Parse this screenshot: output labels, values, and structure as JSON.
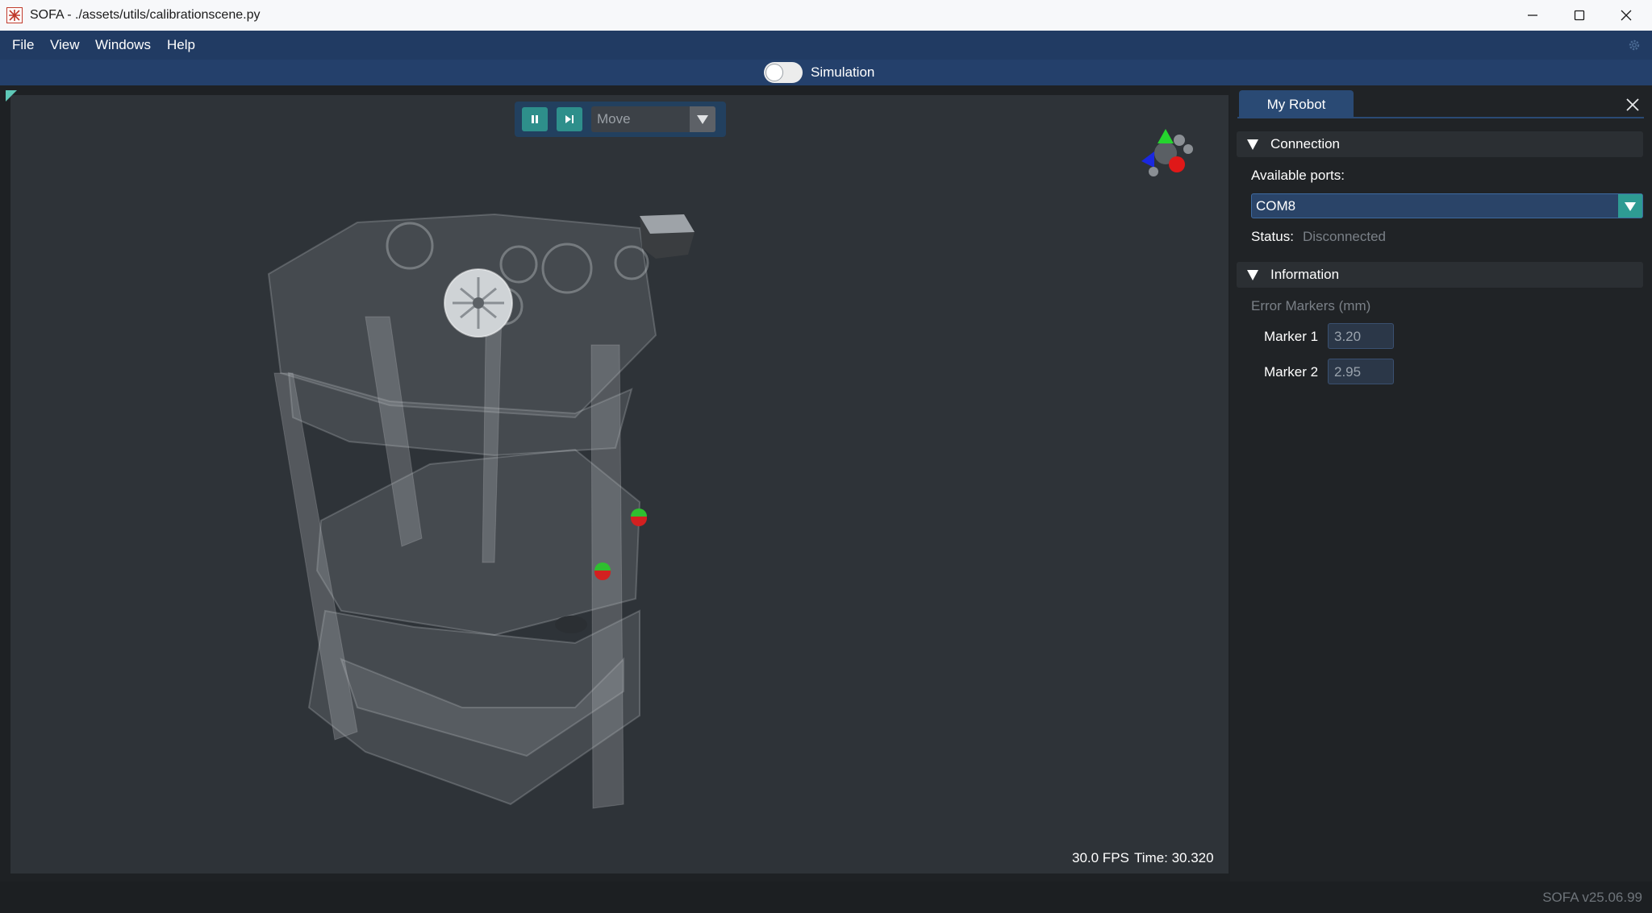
{
  "window": {
    "title": "SOFA - ./assets/utils/calibrationscene.py",
    "controls": [
      "minimize-icon",
      "maximize-icon",
      "close-icon"
    ]
  },
  "menu": {
    "items": [
      "File",
      "View",
      "Windows",
      "Help"
    ],
    "settings_icon": "gear-icon"
  },
  "simulation_bar": {
    "label": "Simulation",
    "toggle_on": false
  },
  "viewport": {
    "toolbar": {
      "pause_icon": "pause-icon",
      "step_icon": "step-forward-icon",
      "mode": "Move"
    },
    "fps": "30.0 FPS",
    "time": "Time: 30.320"
  },
  "panel": {
    "tab": "My Robot",
    "connection": {
      "header": "Connection",
      "ports_label": "Available ports:",
      "port_value": "COM8",
      "status_label": "Status:",
      "status_value": "Disconnected"
    },
    "information": {
      "header": "Information",
      "error_label": "Error Markers (mm)",
      "markers": [
        {
          "label": "Marker 1",
          "value": "3.20"
        },
        {
          "label": "Marker 2",
          "value": "2.95"
        }
      ]
    }
  },
  "status_bar": {
    "version": "SOFA v25.06.99"
  },
  "colors": {
    "menu_bg": "#213b63",
    "sim_bar_bg": "#24406b",
    "accent_teal": "#2e9b93",
    "viewport_bg": "#2e3338",
    "marker_green": "#2fbf2f",
    "marker_red": "#d32020"
  }
}
